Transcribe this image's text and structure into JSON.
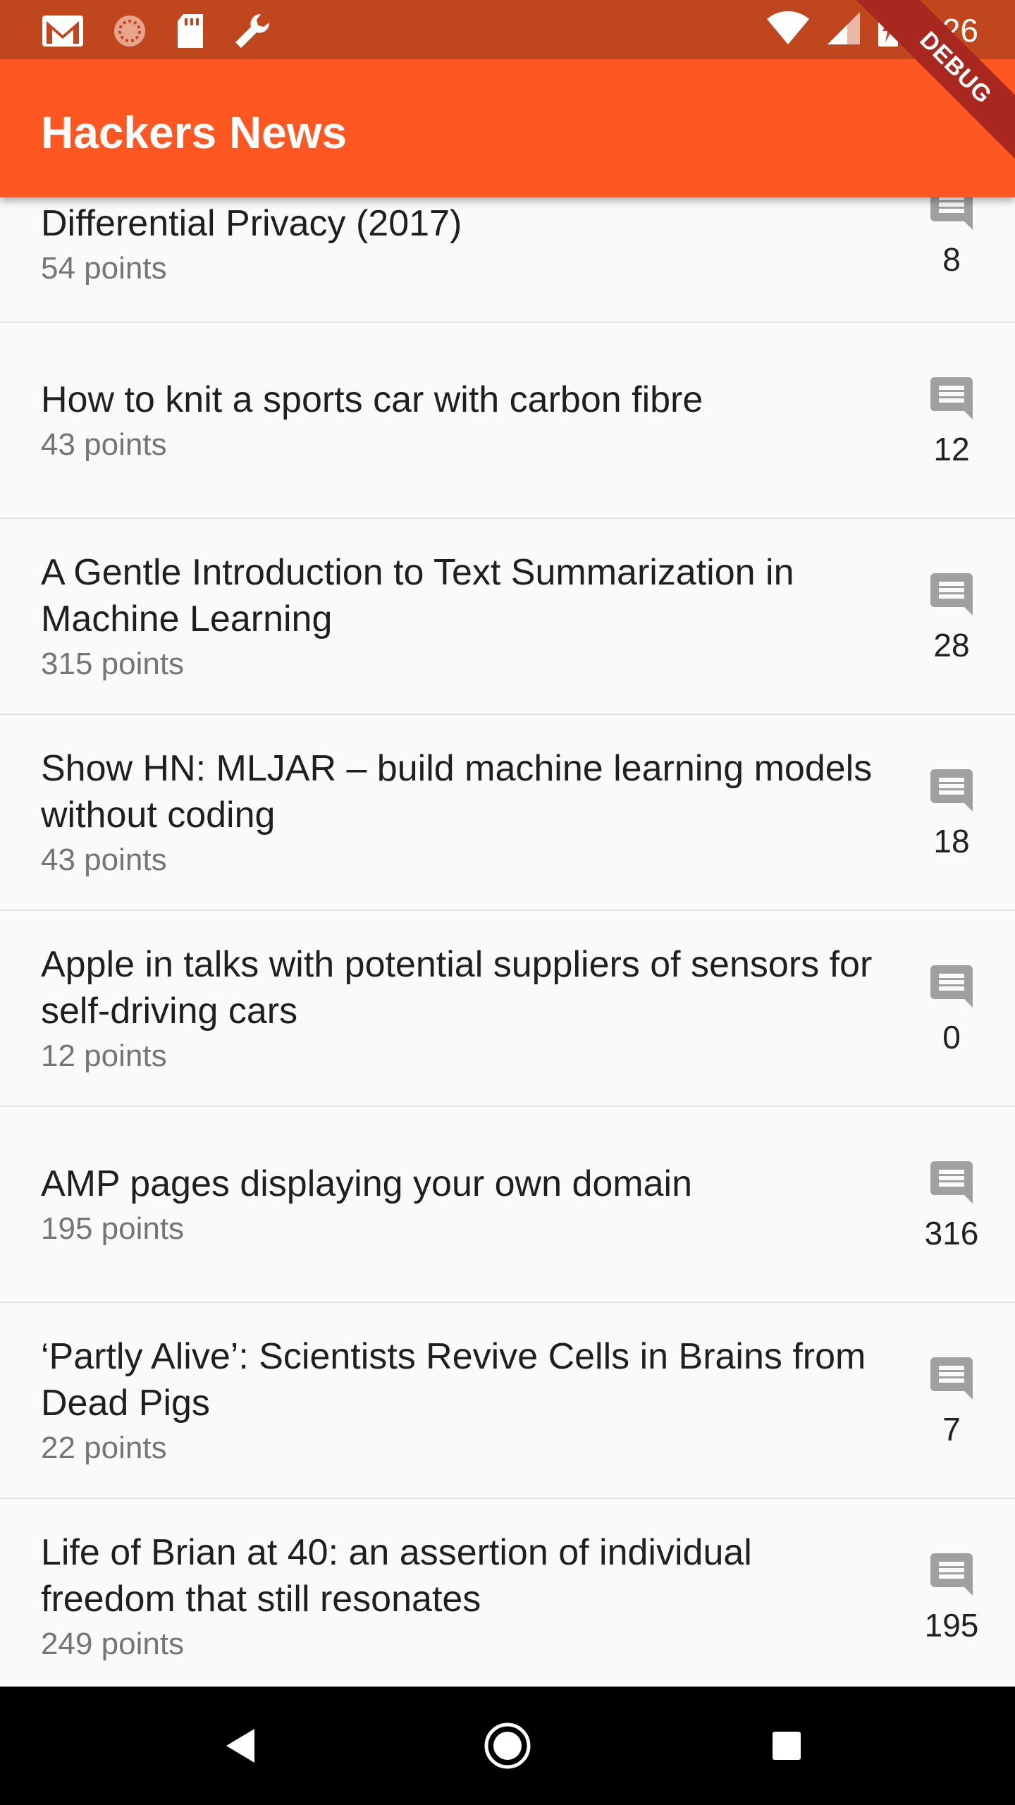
{
  "status_bar": {
    "time": "4:26",
    "left_icons": [
      "gmail-icon",
      "spinner-icon",
      "sd-card-icon",
      "wrench-icon"
    ],
    "right_icons": [
      "wifi-icon",
      "cell-signal-icon",
      "battery-charging-icon"
    ]
  },
  "app_bar": {
    "title": "Hackers News",
    "color": "#ff5722"
  },
  "debug_banner": "DEBUG",
  "stories": [
    {
      "title": "Differential Privacy (2017)",
      "points": "54 points",
      "comments": "8"
    },
    {
      "title": "How to knit a sports car with carbon fibre",
      "points": "43 points",
      "comments": "12"
    },
    {
      "title": "A Gentle Introduction to Text Summarization in Machine Learning",
      "points": "315 points",
      "comments": "28"
    },
    {
      "title": "Show HN: MLJAR – build machine learning models without coding",
      "points": "43 points",
      "comments": "18"
    },
    {
      "title": "Apple in talks with potential suppliers of sensors for self-driving cars",
      "points": "12 points",
      "comments": "0"
    },
    {
      "title": "AMP pages displaying your own domain",
      "points": "195 points",
      "comments": "316"
    },
    {
      "title": "‘Partly Alive’: Scientists Revive Cells in Brains from Dead Pigs",
      "points": "22 points",
      "comments": "7"
    },
    {
      "title": "Life of Brian at 40: an assertion of individual freedom that still resonates",
      "points": "249 points",
      "comments": "195"
    }
  ],
  "nav_bar": {
    "buttons": [
      "back-button",
      "home-button",
      "recents-button"
    ]
  }
}
